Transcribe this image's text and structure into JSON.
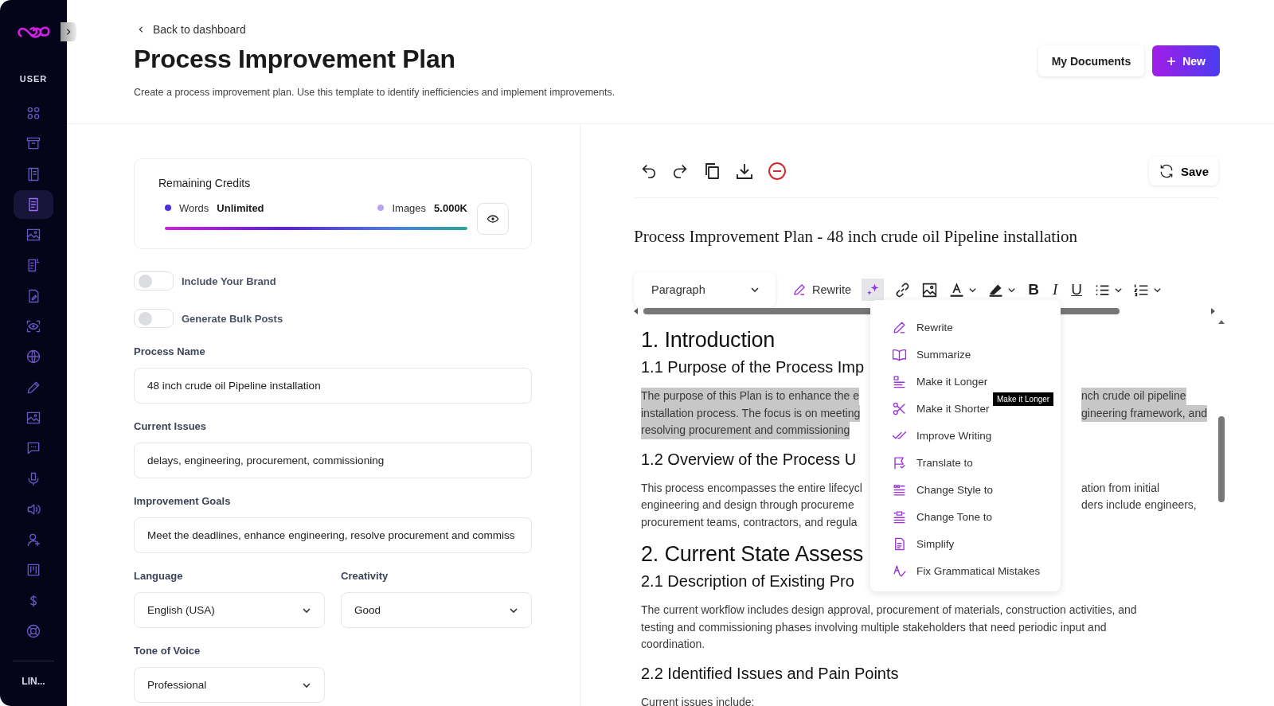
{
  "sidebar": {
    "section_label": "USER",
    "footer_label": "LIN...",
    "items": [
      {
        "selected": false
      },
      {
        "selected": false
      },
      {
        "selected": false
      },
      {
        "selected": true
      },
      {
        "selected": false
      },
      {
        "selected": false
      },
      {
        "selected": false
      },
      {
        "selected": false
      },
      {
        "selected": false
      },
      {
        "selected": false
      },
      {
        "selected": false
      },
      {
        "selected": false
      },
      {
        "selected": false
      },
      {
        "selected": false
      },
      {
        "selected": false
      },
      {
        "selected": false
      },
      {
        "selected": false
      },
      {
        "selected": false
      }
    ]
  },
  "header": {
    "back_link": "Back to dashboard",
    "title": "Process Improvement Plan",
    "subtitle": "Create a process improvement plan. Use this template to identify inefficiencies and implement improvements.",
    "buttons": [
      {
        "label": "My Documents",
        "kind": "secondary"
      },
      {
        "label": "New",
        "kind": "primary"
      }
    ]
  },
  "credits": {
    "title": "Remaining Credits",
    "items": [
      {
        "label": "Words",
        "value": "Unlimited",
        "color": "#4b2fe0"
      },
      {
        "label": "Images",
        "value": "5.000K",
        "color": "#b9a4f0"
      }
    ]
  },
  "toggles": [
    {
      "label": "Include Your Brand",
      "on": false
    },
    {
      "label": "Generate Bulk Posts",
      "on": false
    }
  ],
  "fields": [
    {
      "label": "Process Name",
      "value": "48 inch crude oil Pipeline installation",
      "kind": "input"
    },
    {
      "label": "Current Issues",
      "value": "delays, engineering, procurement, commissioning",
      "kind": "input"
    },
    {
      "label": "Improvement Goals",
      "value": "Meet the deadlines, enhance engineering, resolve procurement and commiss",
      "kind": "input"
    },
    {
      "label": "Language",
      "value": "English (USA)",
      "kind": "select"
    },
    {
      "label": "Creativity",
      "value": "Good",
      "kind": "select"
    },
    {
      "label": "Tone of Voice",
      "value": "Professional",
      "kind": "select"
    }
  ],
  "editor": {
    "save_label": "Save",
    "doc_title": "Process Improvement Plan - 48 inch crude oil Pipeline installation",
    "block_style": "Paragraph",
    "rewrite_label": "Rewrite",
    "bold": "B",
    "italic": "I",
    "underline": "U",
    "ai_menu": {
      "open": true,
      "tooltip": "Make it Longer",
      "items": [
        "Rewrite",
        "Summarize",
        "Make it Longer",
        "Make it Shorter",
        "Improve Writing",
        "Translate to",
        "Change Style to",
        "Change Tone to",
        "Simplify",
        "Fix Grammatical Mistakes"
      ]
    },
    "content": [
      {
        "kind": "h1",
        "text": "1. Introduction"
      },
      {
        "kind": "h2",
        "text": "1.1 Purpose of the Process Imp"
      },
      {
        "kind": "p",
        "highlighted": true,
        "lines": [
          {
            "left": "The purpose of this Plan is to enhance the e",
            "right": "nch crude oil pipeline"
          },
          {
            "left": "installation process. The focus is on meeting",
            "right": "gineering framework, and"
          },
          {
            "left": "resolving procurement and commissioning"
          }
        ]
      },
      {
        "kind": "h2",
        "text": "1.2 Overview of the Process U"
      },
      {
        "kind": "p",
        "highlighted": false,
        "lines": [
          {
            "left": "This process encompasses the entire lifecycl",
            "right": "ation from initial"
          },
          {
            "left": "engineering and design through procureme",
            "right": "ders include engineers,"
          },
          {
            "left": "procurement teams, contractors, and regula"
          }
        ]
      },
      {
        "kind": "h1",
        "text": "2. Current State Assess"
      },
      {
        "kind": "h2",
        "text": "2.1 Description of Existing Pro"
      },
      {
        "kind": "p",
        "highlighted": false,
        "lines": [
          {
            "left": "The current workflow includes design approval, procurement of materials, construction activities, and"
          },
          {
            "left": "testing and commissioning phases involving multiple stakeholders that need periodic input and"
          },
          {
            "left": "coordination."
          }
        ]
      },
      {
        "kind": "h2",
        "text": "2.2 Identified Issues and Pain Points"
      },
      {
        "kind": "p",
        "highlighted": false,
        "lines": [
          {
            "left": "Current issues include:"
          }
        ]
      }
    ]
  }
}
